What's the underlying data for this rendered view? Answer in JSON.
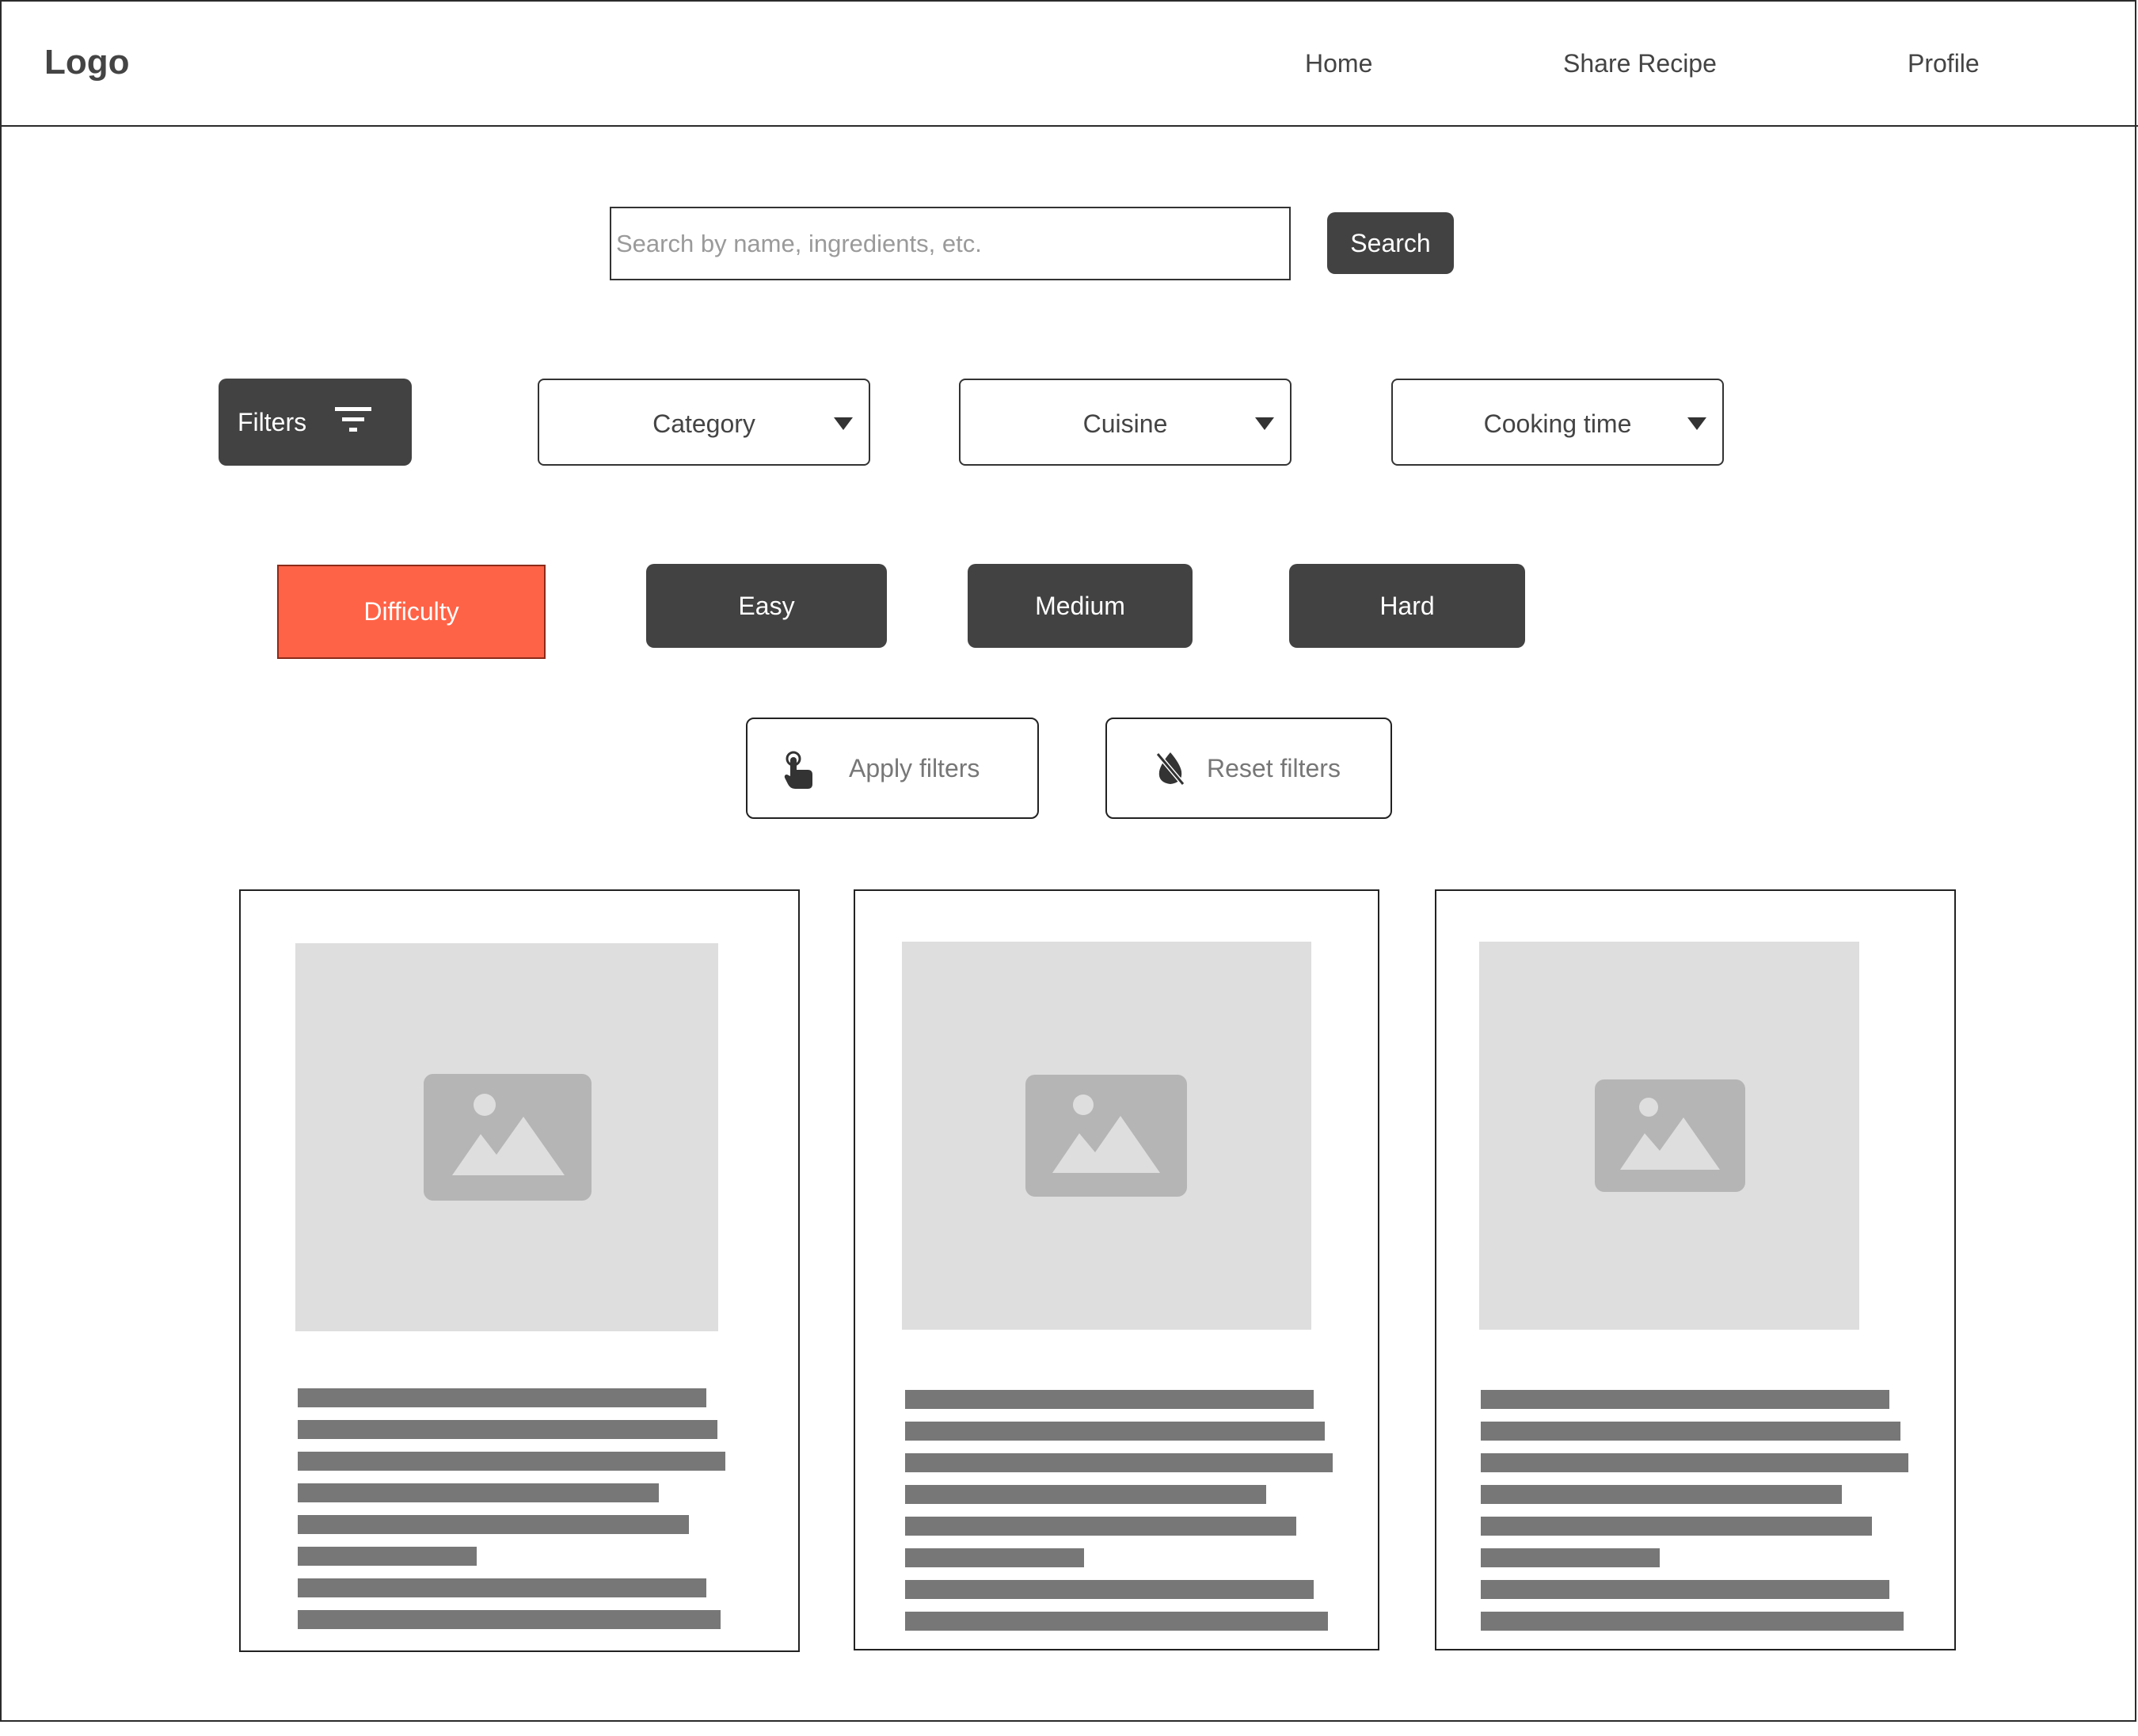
{
  "header": {
    "logo": "Logo",
    "nav": [
      "Home",
      "Share Recipe",
      "Profile"
    ]
  },
  "search": {
    "placeholder": "Search by name, ingredients, etc.",
    "value": "",
    "button_label": "Search"
  },
  "filters": {
    "button_label": "Filters",
    "dropdowns": [
      "Category",
      "Cuisine",
      "Cooking time"
    ]
  },
  "difficulty": {
    "label": "Difficulty",
    "options": [
      "Easy",
      "Medium",
      "Hard"
    ]
  },
  "actions": {
    "apply_label": "Apply filters",
    "reset_label": "Reset filters"
  },
  "colors": {
    "accent": "#ff6347",
    "dark_button": "#424242",
    "placeholder_gray": "#dedede",
    "text_bar": "#777777"
  },
  "cards": [
    {
      "image": "image-placeholder-icon",
      "text_lines": 8
    },
    {
      "image": "image-placeholder-icon",
      "text_lines": 8
    },
    {
      "image": "image-placeholder-icon",
      "text_lines": 8
    }
  ]
}
